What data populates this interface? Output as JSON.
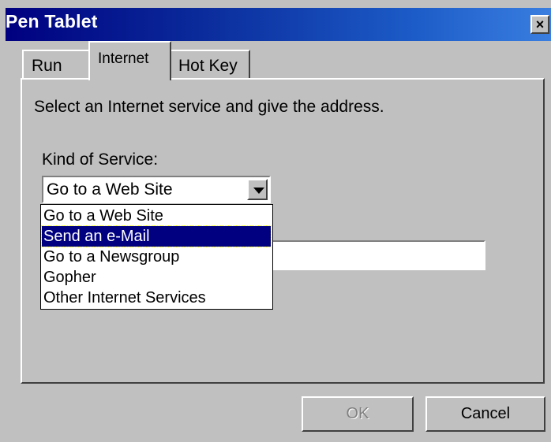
{
  "window": {
    "title": "Pen Tablet",
    "close_glyph": "×"
  },
  "tabs": [
    {
      "label": "Run"
    },
    {
      "label": "Internet"
    },
    {
      "label": "Hot Key"
    }
  ],
  "panel": {
    "instruction": "Select an Internet service and give the address.",
    "service_label": "Kind of Service:",
    "service_value": "Go to a Web Site",
    "options": [
      {
        "label": "Go to a Web Site"
      },
      {
        "label": "Send an e-Mail"
      },
      {
        "label": "Go to a Newsgroup"
      },
      {
        "label": "Gopher"
      },
      {
        "label": "Other Internet Services"
      }
    ]
  },
  "buttons": {
    "ok": "OK",
    "cancel": "Cancel"
  },
  "colors": {
    "title_start": "#000080",
    "title_end": "#3a7ee0",
    "selection": "#000080",
    "face": "#c0c0c0"
  }
}
